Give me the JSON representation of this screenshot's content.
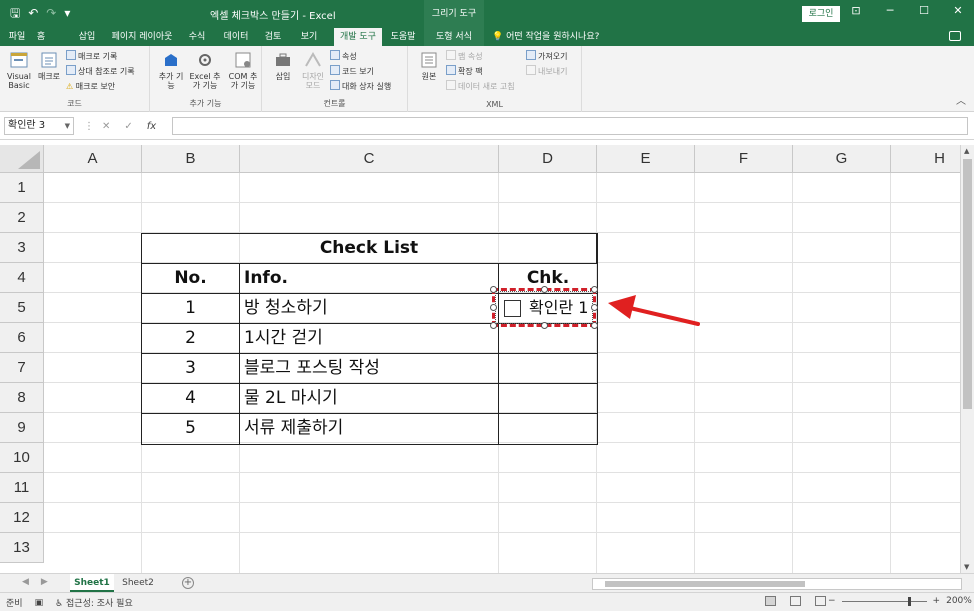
{
  "window": {
    "qat_save": "🖫",
    "qat_undo": "↶",
    "qat_redo": "↷",
    "qat_more": "▾",
    "doc_title": "엑셀 체크박스 만들기  -  Excel",
    "draw_tools_header": "그리기 도구",
    "login": "로그인",
    "ribbon_display": "⊡",
    "minimize": "─",
    "restore": "☐",
    "close": "✕"
  },
  "tabs": [
    {
      "label": "파일"
    },
    {
      "label": "홈"
    },
    {
      "label": "삽입"
    },
    {
      "label": "페이지 레이아웃"
    },
    {
      "label": "수식"
    },
    {
      "label": "데이터"
    },
    {
      "label": "검토"
    },
    {
      "label": "보기"
    },
    {
      "label": "개발 도구"
    },
    {
      "label": "도움말"
    },
    {
      "label": "도형 서식"
    }
  ],
  "tellme": "어떤 작업을 원하시나요?",
  "ribbon": {
    "code_group": {
      "label": "코드",
      "visual_basic": "Visual Basic",
      "macro": "매크로",
      "record_macro": "매크로 기록",
      "relative_ref": "상대 참조로 기록",
      "macro_security": "매크로 보안"
    },
    "addins_group": {
      "label": "추가 기능",
      "addins": "추가 기능",
      "excel_addins": "Excel 추가 기능",
      "com_addins": "COM 추가 기능"
    },
    "controls_group": {
      "label": "컨트롤",
      "insert": "삽입",
      "design_mode": "디자인 모드",
      "properties": "속성",
      "view_code": "코드 보기",
      "run_dialog": "대화 상자 실행"
    },
    "xml_group": {
      "label": "XML",
      "source": "원본",
      "map_props": "맵 속성",
      "expansion_packs": "확장 팩",
      "refresh_data": "데이터 새로 고침",
      "import": "가져오기",
      "export": "내보내기"
    }
  },
  "formula_bar": {
    "name_box": "확인란 3",
    "cancel": "✕",
    "enter": "✓",
    "fx": "fx",
    "value": ""
  },
  "columns": [
    "A",
    "B",
    "C",
    "D",
    "E",
    "F",
    "G",
    "H"
  ],
  "rows": [
    "1",
    "2",
    "3",
    "4",
    "5",
    "6",
    "7",
    "8",
    "9",
    "10",
    "11",
    "12",
    "13"
  ],
  "checklist": {
    "title": "Check List",
    "headers": {
      "no": "No.",
      "info": "Info.",
      "chk": "Chk."
    },
    "items": [
      {
        "no": "1",
        "info": "방 청소하기"
      },
      {
        "no": "2",
        "info": "1시간 걷기"
      },
      {
        "no": "3",
        "info": "블로그 포스팅 작성"
      },
      {
        "no": "4",
        "info": "물 2L 마시기"
      },
      {
        "no": "5",
        "info": "서류 제출하기"
      }
    ]
  },
  "checkbox_control": {
    "label": "확인란 1",
    "checked": false
  },
  "annotation_color": "#e02020",
  "sheets": [
    {
      "label": "Sheet1",
      "active": true
    },
    {
      "label": "Sheet2",
      "active": false
    }
  ],
  "status": {
    "ready": "준비",
    "accessibility": "접근성: 조사 필요",
    "zoom_minus": "−",
    "zoom_plus": "+",
    "zoom_level": "200%"
  }
}
